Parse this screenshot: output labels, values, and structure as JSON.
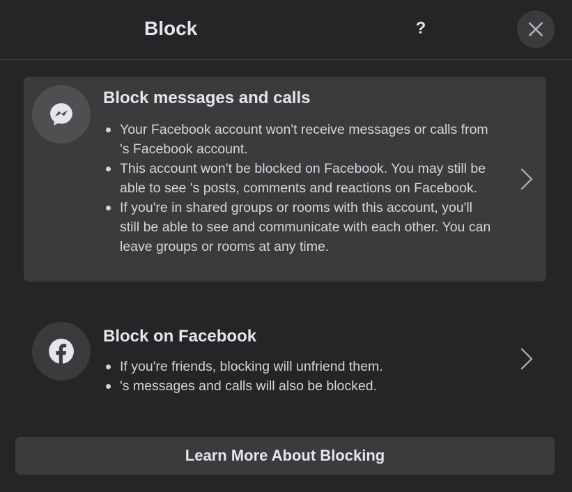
{
  "dialog": {
    "title": "Block",
    "help_label": "?",
    "close_icon": "close-icon"
  },
  "options": [
    {
      "icon": "messenger-icon",
      "title": "Block messages and calls",
      "bullets": [
        "Your Facebook account won't receive messages or calls from           's Facebook account.",
        "This account won't be blocked on Facebook. You may still be able to see           's posts, comments and reactions on Facebook.",
        "If you're in shared groups or rooms with this account, you'll still be able to see and communicate with each other. You can leave groups or rooms at any time."
      ],
      "chevron_icon": "chevron-right-icon",
      "selected": true
    },
    {
      "icon": "facebook-icon",
      "title": "Block on Facebook",
      "bullets": [
        "If you're friends, blocking           will unfriend them.",
        "           's messages and calls will also be blocked."
      ],
      "chevron_icon": "chevron-right-icon",
      "selected": false
    }
  ],
  "footer": {
    "learn_more_label": "Learn More About Blocking"
  },
  "colors": {
    "background": "#242526",
    "surface": "#3a3b3c",
    "text_primary": "#e4e6eb",
    "text_secondary": "#d3d5d9"
  }
}
